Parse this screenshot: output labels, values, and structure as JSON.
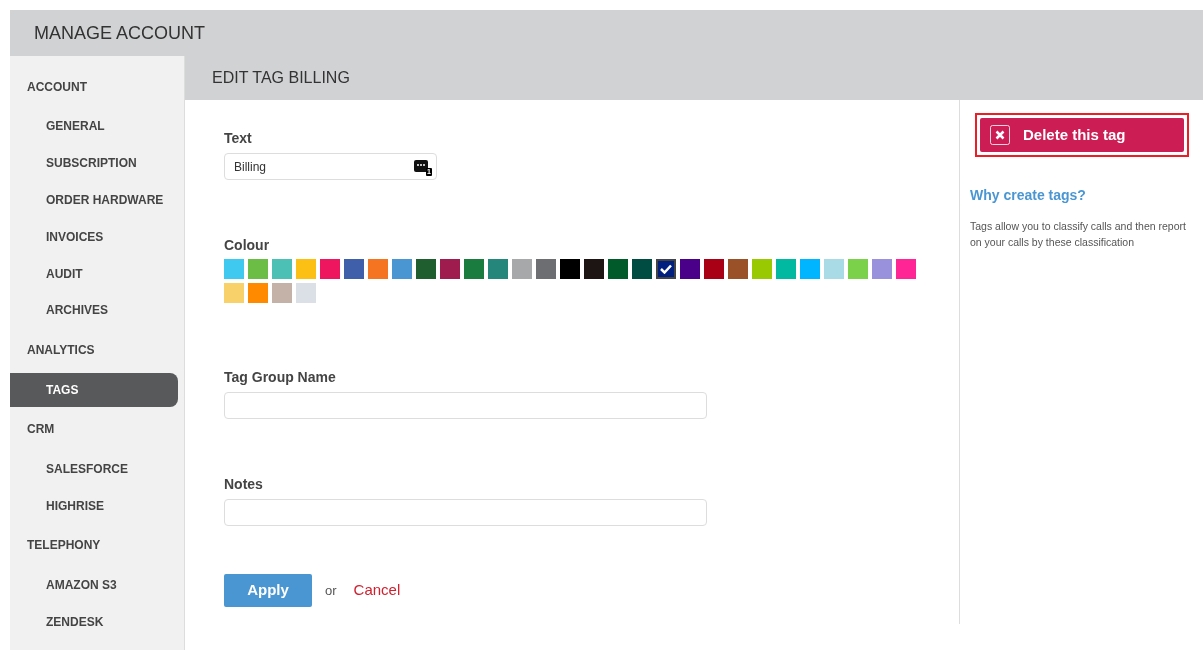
{
  "header": {
    "title": "MANAGE ACCOUNT"
  },
  "sidebar": {
    "sections": [
      {
        "label": "ACCOUNT",
        "children": [
          {
            "label": "GENERAL",
            "selected": false
          },
          {
            "label": "SUBSCRIPTION",
            "selected": false
          },
          {
            "label": "ORDER HARDWARE",
            "selected": false
          },
          {
            "label": "INVOICES",
            "selected": false
          },
          {
            "label": "AUDIT",
            "selected": false
          },
          {
            "label": "ARCHIVES",
            "selected": false
          }
        ]
      },
      {
        "label": "ANALYTICS",
        "children": [
          {
            "label": "TAGS",
            "selected": true
          }
        ]
      },
      {
        "label": "CRM",
        "children": [
          {
            "label": "SALESFORCE",
            "selected": false
          },
          {
            "label": "HIGHRISE",
            "selected": false
          }
        ]
      },
      {
        "label": "TELEPHONY",
        "children": [
          {
            "label": "AMAZON S3",
            "selected": false
          },
          {
            "label": "ZENDESK",
            "selected": false
          }
        ]
      }
    ]
  },
  "content": {
    "title": "EDIT TAG BILLING",
    "text_field": {
      "label": "Text",
      "value": "Billing",
      "badge": "1"
    },
    "colour": {
      "label": "Colour",
      "swatches": [
        {
          "color": "#3fc8f0",
          "selected": false
        },
        {
          "color": "#6cbd45",
          "selected": false
        },
        {
          "color": "#4dc0b5",
          "selected": false
        },
        {
          "color": "#fcc015",
          "selected": false
        },
        {
          "color": "#ef1660",
          "selected": false
        },
        {
          "color": "#3f5faa",
          "selected": false
        },
        {
          "color": "#f47421",
          "selected": false
        },
        {
          "color": "#4a96d3",
          "selected": false
        },
        {
          "color": "#1f5e2f",
          "selected": false
        },
        {
          "color": "#9f1c4f",
          "selected": false
        },
        {
          "color": "#1a7c3f",
          "selected": false
        },
        {
          "color": "#25877c",
          "selected": false
        },
        {
          "color": "#a7a8aa",
          "selected": false
        },
        {
          "color": "#6d6e71",
          "selected": false
        },
        {
          "color": "#000000",
          "selected": false
        },
        {
          "color": "#1d1414",
          "selected": false
        },
        {
          "color": "#005a2a",
          "selected": false
        },
        {
          "color": "#004b42",
          "selected": false
        },
        {
          "color": "#001f7f",
          "selected": true
        },
        {
          "color": "#4b0089",
          "selected": false
        },
        {
          "color": "#a90015",
          "selected": false
        },
        {
          "color": "#9a5128",
          "selected": false
        },
        {
          "color": "#99c900",
          "selected": false
        },
        {
          "color": "#00b9a0",
          "selected": false
        },
        {
          "color": "#00b5ff",
          "selected": false
        },
        {
          "color": "#a8dbe6",
          "selected": false
        },
        {
          "color": "#7cd14b",
          "selected": false
        },
        {
          "color": "#9a91dc",
          "selected": false
        },
        {
          "color": "#ff2594",
          "selected": false
        },
        {
          "color": "#f9d16a",
          "selected": false
        },
        {
          "color": "#ff8a00",
          "selected": false
        },
        {
          "color": "#c4b2a9",
          "selected": false
        },
        {
          "color": "#dbe0e6",
          "selected": false
        }
      ]
    },
    "group_field": {
      "label": "Tag Group Name"
    },
    "notes_field": {
      "label": "Notes"
    },
    "actions": {
      "apply": "Apply",
      "or": "or",
      "cancel": "Cancel"
    }
  },
  "side_panel": {
    "delete_button": "Delete this tag",
    "help_title": "Why create tags?",
    "help_text": "Tags allow you to classify calls and then report on your calls by these classification"
  }
}
